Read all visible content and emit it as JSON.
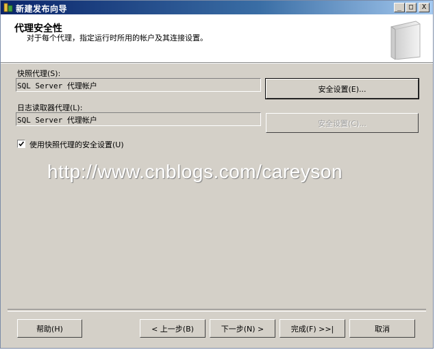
{
  "window": {
    "title": "新建发布向导",
    "controls": {
      "minimize": "_",
      "maximize": "□",
      "close": "X"
    }
  },
  "header": {
    "title": "代理安全性",
    "subtitle": "对于每个代理，指定运行时所用的帐户及其连接设置。"
  },
  "snapshot_agent": {
    "label": "快照代理(S):",
    "value": "SQL Server 代理帐户",
    "button": "安全设置(E)..."
  },
  "log_reader_agent": {
    "label": "日志读取器代理(L):",
    "value": "SQL Server 代理帐户",
    "button": "安全设置(C)..."
  },
  "use_snapshot_settings": {
    "label": "使用快照代理的安全设置(U)",
    "checked": true
  },
  "watermark": "http://www.cnblogs.com/careyson",
  "footer": {
    "help": "帮助(H)",
    "back": "< 上一步(B)",
    "next": "下一步(N) >",
    "finish": "完成(F) >>|",
    "cancel": "取消"
  }
}
